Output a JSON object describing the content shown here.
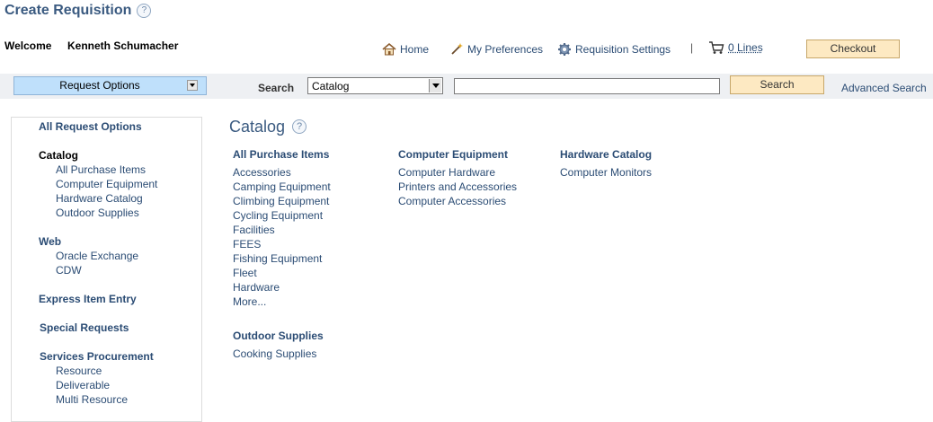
{
  "page": {
    "title": "Create Requisition",
    "help_glyph": "?"
  },
  "header": {
    "welcome": "Welcome",
    "user": "Kenneth Schumacher",
    "home": "Home",
    "preferences": "My Preferences",
    "settings": "Requisition Settings",
    "separator": "|",
    "lines": "0 Lines",
    "checkout": "Checkout"
  },
  "searchbar": {
    "request_options": "Request Options",
    "search_label": "Search",
    "selected_option": "Catalog",
    "search_value": "",
    "search_button": "Search",
    "advanced": "Advanced Search"
  },
  "sidebar": {
    "all_request_options": "All Request Options",
    "catalog": "Catalog",
    "catalog_items": [
      "All Purchase Items",
      "Computer Equipment",
      "Hardware Catalog",
      "Outdoor Supplies"
    ],
    "web": "Web",
    "web_items": [
      "Oracle Exchange",
      "CDW"
    ],
    "express": "Express Item Entry",
    "special": "Special Requests",
    "services": "Services Procurement",
    "services_items": [
      "Resource",
      "Deliverable",
      "Multi Resource"
    ]
  },
  "main": {
    "title": "Catalog",
    "col1": {
      "heading": "All Purchase Items",
      "items": [
        "Accessories",
        "Camping Equipment",
        "Climbing Equipment",
        "Cycling Equipment",
        "Facilities",
        "FEES",
        "Fishing Equipment",
        "Fleet",
        "Hardware",
        "More..."
      ]
    },
    "col1b": {
      "heading": "Outdoor Supplies",
      "items": [
        "Cooking Supplies"
      ]
    },
    "col2": {
      "heading": "Computer Equipment",
      "items": [
        "Computer Hardware",
        "Printers and Accessories",
        "Computer Accessories"
      ]
    },
    "col3": {
      "heading": "Hardware Catalog",
      "items": [
        "Computer Monitors"
      ]
    }
  },
  "colors": {
    "link": "#2b4c74",
    "title": "#3a5a80",
    "button": "#fde9c2",
    "request_options_bg": "#bfe0fb"
  }
}
